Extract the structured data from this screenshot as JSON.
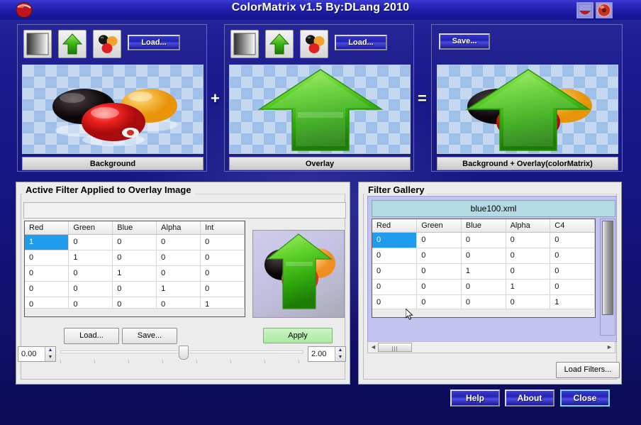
{
  "window": {
    "title": "ColorMatrix v1.5 By:DLang 2010",
    "logo_icon": "red-ball-logo-icon",
    "titlebar_buttons": [
      {
        "name": "minimize-cup-icon",
        "label": ""
      },
      {
        "name": "close-donut-icon",
        "label": ""
      }
    ]
  },
  "images": {
    "background": {
      "caption": "Background",
      "tools": [
        {
          "icon": "gradient-square-icon",
          "label": ""
        },
        {
          "icon": "green-arrow-icon",
          "label": ""
        },
        {
          "icon": "colored-balls-icon",
          "label": ""
        }
      ],
      "load_label": "Load..."
    },
    "overlay": {
      "caption": "Overlay",
      "tools": [
        {
          "icon": "gradient-square-icon",
          "label": ""
        },
        {
          "icon": "green-arrow-icon",
          "label": ""
        },
        {
          "icon": "colored-balls-icon",
          "label": ""
        }
      ],
      "load_label": "Load..."
    },
    "result": {
      "caption": "Background + Overlay(colorMatrix)",
      "save_label": "Save..."
    },
    "operator_plus": "+",
    "operator_equals": "="
  },
  "active_filter": {
    "panel_title": "Active Filter Applied to Overlay Image",
    "filter_name_value": "",
    "columns": [
      "Red",
      "Green",
      "Blue",
      "Alpha",
      "Int"
    ],
    "rows": [
      [
        "1",
        "0",
        "0",
        "0",
        "0"
      ],
      [
        "0",
        "1",
        "0",
        "0",
        "0"
      ],
      [
        "0",
        "0",
        "1",
        "0",
        "0"
      ],
      [
        "0",
        "0",
        "0",
        "1",
        "0"
      ],
      [
        "0",
        "0",
        "0",
        "0",
        "1"
      ]
    ],
    "selected_cell": {
      "row": 0,
      "col": 0
    },
    "buttons": {
      "load": "Load...",
      "save": "Save...",
      "apply": "Apply"
    },
    "range": {
      "min_value": "0.00",
      "max_value": "2.00",
      "slider_position_percent": 49
    }
  },
  "filter_gallery": {
    "panel_title": "Filter Gallery",
    "selected_file": "blue100.xml",
    "columns": [
      "Red",
      "Green",
      "Blue",
      "Alpha",
      "C4"
    ],
    "rows": [
      [
        "0",
        "0",
        "0",
        "0",
        "0"
      ],
      [
        "0",
        "0",
        "0",
        "0",
        "0"
      ],
      [
        "0",
        "0",
        "1",
        "0",
        "0"
      ],
      [
        "0",
        "0",
        "0",
        "1",
        "0"
      ],
      [
        "0",
        "0",
        "0",
        "0",
        "1"
      ]
    ],
    "selected_cell": {
      "row": 0,
      "col": 0
    },
    "load_filters_label": "Load Filters...",
    "scroll_left_arrow": "◄",
    "scroll_right_arrow": "►"
  },
  "dialog_buttons": {
    "help": "Help",
    "about": "About",
    "close": "Close"
  },
  "colors": {
    "titlebar_blue": "#1d1da8",
    "selection_blue": "#1f9ced",
    "apply_green": "#abeba2",
    "gallery_header": "#b4dbe4",
    "gallery_background": "#c3c3f0"
  }
}
